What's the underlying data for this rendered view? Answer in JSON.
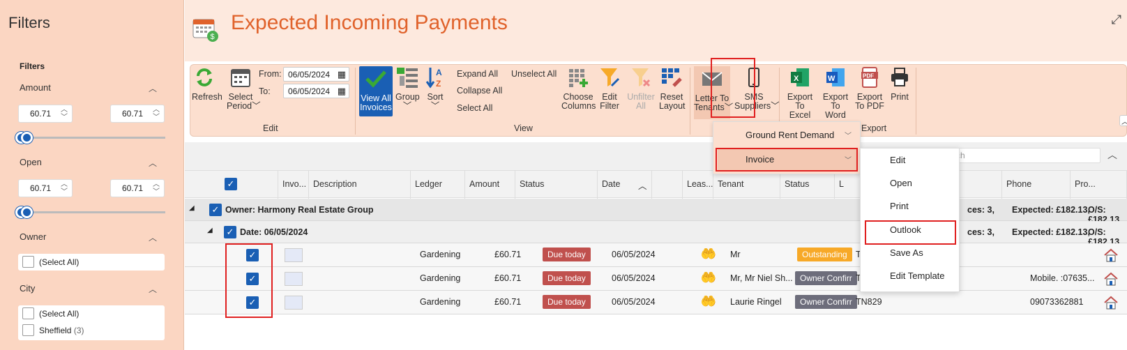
{
  "sidebar": {
    "title": "Filters",
    "heading": "Filters",
    "amount": {
      "label": "Amount",
      "min": "60.71",
      "max": "60.71"
    },
    "open": {
      "label": "Open",
      "min": "60.71",
      "max": "60.71"
    },
    "owner": {
      "label": "Owner",
      "items": [
        {
          "label": "(Select All)"
        }
      ]
    },
    "city": {
      "label": "City",
      "items": [
        {
          "label": "(Select All)",
          "count": ""
        },
        {
          "label": "Sheffield",
          "count": "(3)"
        }
      ]
    }
  },
  "header": {
    "title": "Expected Incoming Payments"
  },
  "ribbon": {
    "refresh": "Refresh",
    "select_period": [
      "Select",
      "Period"
    ],
    "from_label": "From:",
    "to_label": "To:",
    "from_value": "06/05/2024",
    "to_value": "06/05/2024",
    "edit_group": "Edit",
    "view_all": [
      "View All",
      "Invoices"
    ],
    "group": "Group",
    "sort": "Sort",
    "expand_all": "Expand All",
    "collapse_all": "Collapse All",
    "select_all": "Select All",
    "unselect_all": "Unselect All",
    "choose_columns": [
      "Choose",
      "Columns"
    ],
    "edit_filter": [
      "Edit",
      "Filter"
    ],
    "unfilter_all": [
      "Unfilter",
      "All"
    ],
    "reset_layout": [
      "Reset",
      "Layout"
    ],
    "view_group": "View",
    "letter_to_tenants": [
      "Letter To",
      "Tenants"
    ],
    "sms_suppliers": [
      "SMS",
      "Suppliers"
    ],
    "export_excel": [
      "Export",
      "To Excel"
    ],
    "export_word": [
      "Export",
      "To Word"
    ],
    "export_pdf": [
      "Export",
      "To PDF"
    ],
    "print": "Print",
    "export_group": "Export"
  },
  "letter_menu": {
    "items": [
      "Ground Rent Demand",
      "Invoice"
    ]
  },
  "invoice_submenu": {
    "items": [
      "Edit",
      "Open",
      "Print",
      "Outlook",
      "Save As",
      "Edit Template"
    ]
  },
  "search": {
    "placeholder": "rch"
  },
  "grid": {
    "columns": [
      "Invo...",
      "Description",
      "Ledger",
      "Amount",
      "Status",
      "Date",
      "Leas...",
      "Tenant",
      "Status",
      "L",
      "Phone",
      "Pro..."
    ],
    "owner_group": "Owner: Harmony Real Estate Group",
    "owner_summary": "ces: 3,",
    "owner_expected": "Expected: £182.13,",
    "owner_os": "O/S: £182.13",
    "date_group": "Date: 06/05/2024",
    "date_summary": "ces: 3,",
    "date_expected": "Expected: £182.13,",
    "date_os": "O/S: £182.13",
    "rows": [
      {
        "ledger": "Gardening",
        "amount": "£60.71",
        "status": "Due today",
        "date": "06/05/2024",
        "tenant": "Mr",
        "tstatus": "Outstanding",
        "lease": "T",
        "phone": ""
      },
      {
        "ledger": "Gardening",
        "amount": "£60.71",
        "status": "Due today",
        "date": "06/05/2024",
        "tenant": "Mr, Mr Niel Sh...",
        "tstatus": "Owner Confirr",
        "lease": "T",
        "phone": "Mobile. :07635..."
      },
      {
        "ledger": "Gardening",
        "amount": "£60.71",
        "status": "Due today",
        "date": "06/05/2024",
        "tenant": "Laurie Ringel",
        "tstatus": "Owner Confirr",
        "lease": "TN829",
        "phone": "09073362881"
      }
    ]
  },
  "colors": {
    "accent": "#e0622b",
    "sidebar_bg": "#fbd6c2",
    "ribbon_bg": "#fcdfcf",
    "check": "#1a5fb4",
    "highlight": "#e01f1f"
  }
}
